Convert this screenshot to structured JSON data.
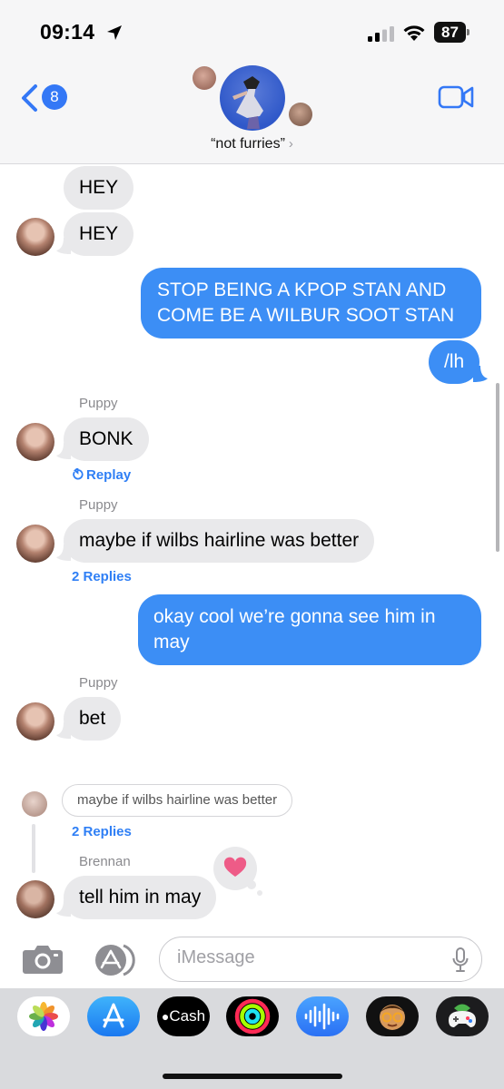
{
  "status_bar": {
    "time": "09:14",
    "battery": "87"
  },
  "header": {
    "back_badge": "8",
    "group_name": "“not furries”",
    "chevron": "›"
  },
  "messages": [
    {
      "text": "HEY"
    },
    {
      "text": "HEY"
    },
    {
      "text_lines": [
        "STOP BEING A KPOP STAN AND",
        "COME BE A WILBUR SOOT STAN"
      ]
    },
    {
      "text": "/lh"
    },
    {
      "sender": "Puppy",
      "text": "BONK",
      "link": "Replay"
    },
    {
      "sender": "Puppy",
      "text": "maybe if wilbs hairline was better",
      "link": "2 Replies"
    },
    {
      "text_lines": [
        "okay cool we’re gonna see him in",
        "may"
      ]
    },
    {
      "sender": "Puppy",
      "text": "bet"
    },
    {
      "quote": "maybe if wilbs hairline was better",
      "link": "2 Replies",
      "sender": "Brennan",
      "text": "tell him in may",
      "tapback": "heart"
    }
  ],
  "composer": {
    "placeholder": "iMessage"
  },
  "app_strip": {
    "cash_label": "Cash",
    "apps": [
      "photos-icon",
      "app-store-icon",
      "apple-cash-icon",
      "activity-icon",
      "audio-message-icon",
      "memoji-icon",
      "game-icon"
    ]
  },
  "colors": {
    "outgoing": "#3c8ef5",
    "incoming": "#e9e9eb",
    "accent": "#2f7ff5",
    "heart": "#ee5b87"
  }
}
